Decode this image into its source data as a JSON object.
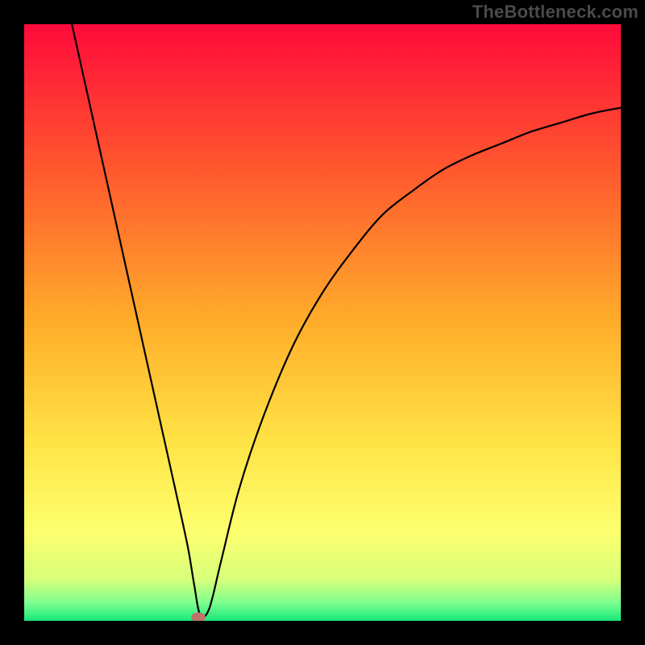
{
  "watermark": "TheBottleneck.com",
  "chart_data": {
    "type": "line",
    "title": "",
    "xlabel": "",
    "ylabel": "",
    "xlim": [
      0,
      100
    ],
    "ylim": [
      0,
      100
    ],
    "grid": false,
    "legend": false,
    "background": {
      "type": "vertical_gradient_top_to_bottom",
      "stops": [
        {
          "pos": 0.0,
          "color": "#ff0a3a"
        },
        {
          "pos": 0.25,
          "color": "#ff5a2e"
        },
        {
          "pos": 0.5,
          "color": "#ffad2a"
        },
        {
          "pos": 0.7,
          "color": "#ffe345"
        },
        {
          "pos": 0.85,
          "color": "#fdff6e"
        },
        {
          "pos": 0.93,
          "color": "#d8ff7a"
        },
        {
          "pos": 0.97,
          "color": "#7dff8f"
        },
        {
          "pos": 1.0,
          "color": "#17e87a"
        }
      ]
    },
    "series": [
      {
        "name": "bottleneck-curve",
        "color": "#000000",
        "x": [
          8,
          10,
          12,
          14,
          16,
          18,
          20,
          22,
          24,
          26,
          27.5,
          28.5,
          29.5,
          31,
          33,
          36,
          40,
          45,
          50,
          55,
          60,
          65,
          70,
          75,
          80,
          85,
          90,
          95,
          100
        ],
        "y": [
          100,
          91,
          82,
          73,
          64,
          55,
          46,
          37,
          28,
          19,
          12,
          6,
          1,
          2,
          10,
          22,
          34,
          46,
          55,
          62,
          68,
          72,
          75.5,
          78,
          80,
          82,
          83.5,
          85,
          86
        ]
      }
    ],
    "markers": [
      {
        "name": "min-point",
        "shape": "ellipse",
        "x": 29.2,
        "y": 0.6,
        "rx": 1.2,
        "ry": 0.8,
        "fill": "#c1716b"
      }
    ]
  }
}
